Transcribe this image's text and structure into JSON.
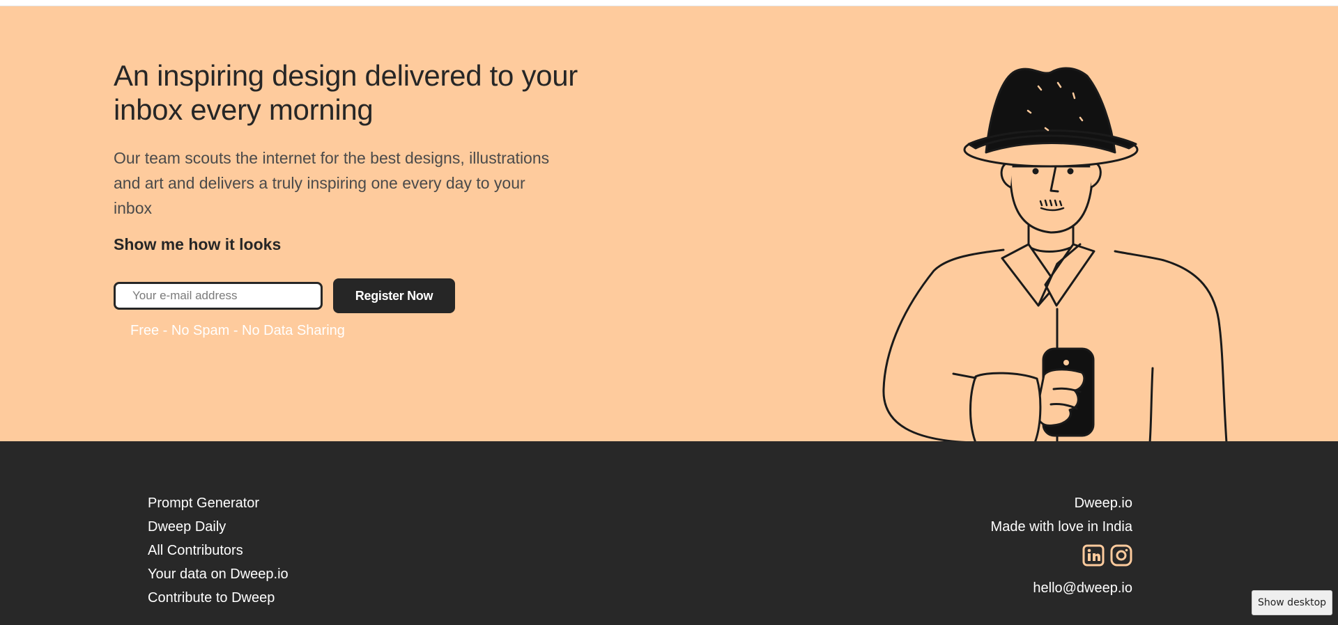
{
  "hero": {
    "title": "An inspiring design delivered to your inbox every morning",
    "subtitle": "Our team scouts the internet for the best designs, illustrations and art and delivers a truly inspiring one every day to your inbox",
    "cta_label": "Show me how it looks",
    "email_placeholder": "Your e-mail address",
    "register_label": "Register Now",
    "note": "Free - No Spam - No Data Sharing",
    "illustration": "man-with-hat-holding-phone"
  },
  "footer": {
    "links": [
      "Prompt Generator",
      "Dweep Daily",
      "All Contributors",
      "Your data on Dweep.io",
      "Contribute to Dweep"
    ],
    "brand": "Dweep.io",
    "tagline": "Made with love in India",
    "socials": [
      "linkedin-icon",
      "instagram-icon"
    ],
    "email": "hello@dweep.io"
  },
  "os": {
    "show_desktop": "Show desktop"
  },
  "colors": {
    "hero_bg": "#fecb9d",
    "footer_bg": "#282828",
    "accent": "#fecb9d",
    "text_dark": "#262626"
  }
}
